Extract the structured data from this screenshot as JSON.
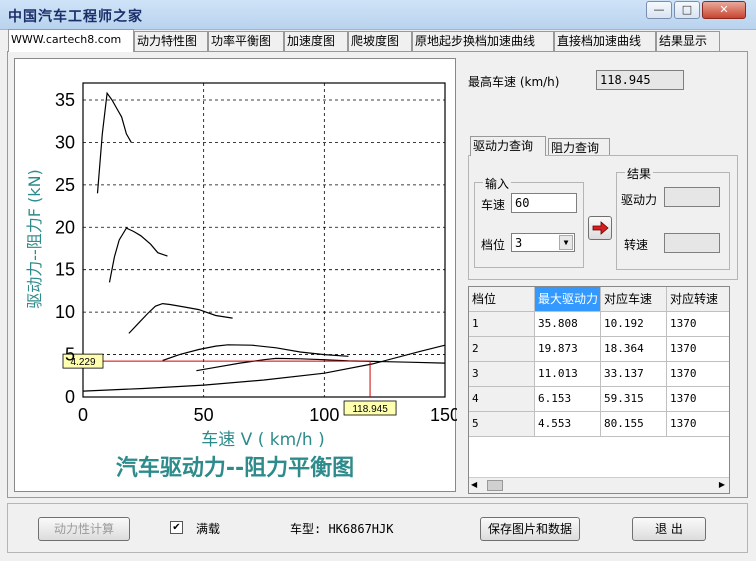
{
  "window": {
    "title": "中国汽车工程师之家",
    "buttons": {
      "minimize": "—",
      "maximize": "□",
      "close": "✕"
    }
  },
  "tabs": [
    {
      "label": "WWW.cartech8.com"
    },
    {
      "label": "动力特性图"
    },
    {
      "label": "功率平衡图"
    },
    {
      "label": "加速度图"
    },
    {
      "label": "爬坡度图"
    },
    {
      "label": "原地起步换档加速曲线"
    },
    {
      "label": "直接档加速曲线"
    },
    {
      "label": "结果显示"
    }
  ],
  "chart_data": {
    "type": "line",
    "title": "汽车驱动力--阻力平衡图",
    "xlabel": "车速 V  ( km/h )",
    "ylabel": "驱动力--阻力F  (kN)",
    "xlim": [
      0,
      150
    ],
    "ylim": [
      0,
      37
    ],
    "xticks": [
      "0",
      "50",
      "100",
      "150"
    ],
    "yticks": [
      "0",
      "5",
      "10",
      "15",
      "20",
      "25",
      "30",
      "35"
    ],
    "grid": true,
    "series": [
      {
        "x": [
          6,
          8,
          10,
          12,
          14,
          16,
          18,
          20
        ],
        "y": [
          24,
          31,
          35.8,
          35,
          34,
          33,
          31,
          30
        ]
      },
      {
        "x": [
          11,
          13,
          15,
          18,
          21,
          24,
          28,
          31,
          35
        ],
        "y": [
          13.5,
          16.5,
          18.5,
          19.9,
          19.5,
          19,
          18,
          17,
          16.6
        ]
      },
      {
        "x": [
          19,
          23,
          27,
          30,
          33,
          36,
          42,
          48,
          55,
          62
        ],
        "y": [
          7.5,
          8.7,
          9.9,
          10.7,
          11,
          10.9,
          10.6,
          10.3,
          9.6,
          9.3
        ]
      },
      {
        "x": [
          33,
          40,
          48,
          55,
          60,
          70,
          80,
          90,
          100,
          110
        ],
        "y": [
          4.3,
          5,
          5.6,
          6,
          6.15,
          6.1,
          5.8,
          5.3,
          5,
          4.8
        ]
      },
      {
        "x": [
          47,
          55,
          65,
          75,
          80,
          90,
          100,
          110,
          120,
          135,
          150
        ],
        "y": [
          3.1,
          3.5,
          4,
          4.4,
          4.55,
          4.5,
          4.4,
          4.25,
          4.2,
          4.1,
          4
        ]
      },
      {
        "x": [
          0,
          25,
          50,
          75,
          100,
          120,
          140,
          150
        ],
        "y": [
          0.7,
          1,
          1.4,
          2,
          2.8,
          3.9,
          5.4,
          6.1
        ]
      }
    ],
    "annotations": {
      "x_value": 118.945,
      "y_value": 4.229,
      "x_label": "118.945",
      "y_label": "4.229"
    },
    "colors": {
      "lines": "#000000",
      "cursor": "#cc0000",
      "title": "#2e8b8b",
      "label_bg": "#ffffb0"
    }
  },
  "right": {
    "max_speed_label": "最高车速 (km/h)",
    "max_speed_value": "118.945",
    "subtabs": [
      {
        "label": "驱动力查询"
      },
      {
        "label": "阻力查询"
      }
    ],
    "input_group": "输入",
    "speed_label": "车速",
    "speed_value": "60",
    "gear_label": "档位",
    "gear_value": "3",
    "result_group": "结果",
    "force_label": "驱动力",
    "force_value": "",
    "rpm_label": "转速",
    "rpm_value": ""
  },
  "table": {
    "columns": [
      "档位",
      "最大驱动力",
      "对应车速",
      "对应转速"
    ],
    "rows": [
      [
        "1",
        "35.808",
        "10.192",
        "1370"
      ],
      [
        "2",
        "19.873",
        "18.364",
        "1370"
      ],
      [
        "3",
        "11.013",
        "33.137",
        "1370"
      ],
      [
        "4",
        "6.153",
        "59.315",
        "1370"
      ],
      [
        "5",
        "4.553",
        "80.155",
        "1370"
      ]
    ]
  },
  "bottom": {
    "calc_button": "动力性计算",
    "full_load_label": "满载",
    "full_load_checked": "✔",
    "model_label": "车型: HK6867HJK",
    "save_button": "保存图片和数据",
    "exit_button": "退  出"
  }
}
